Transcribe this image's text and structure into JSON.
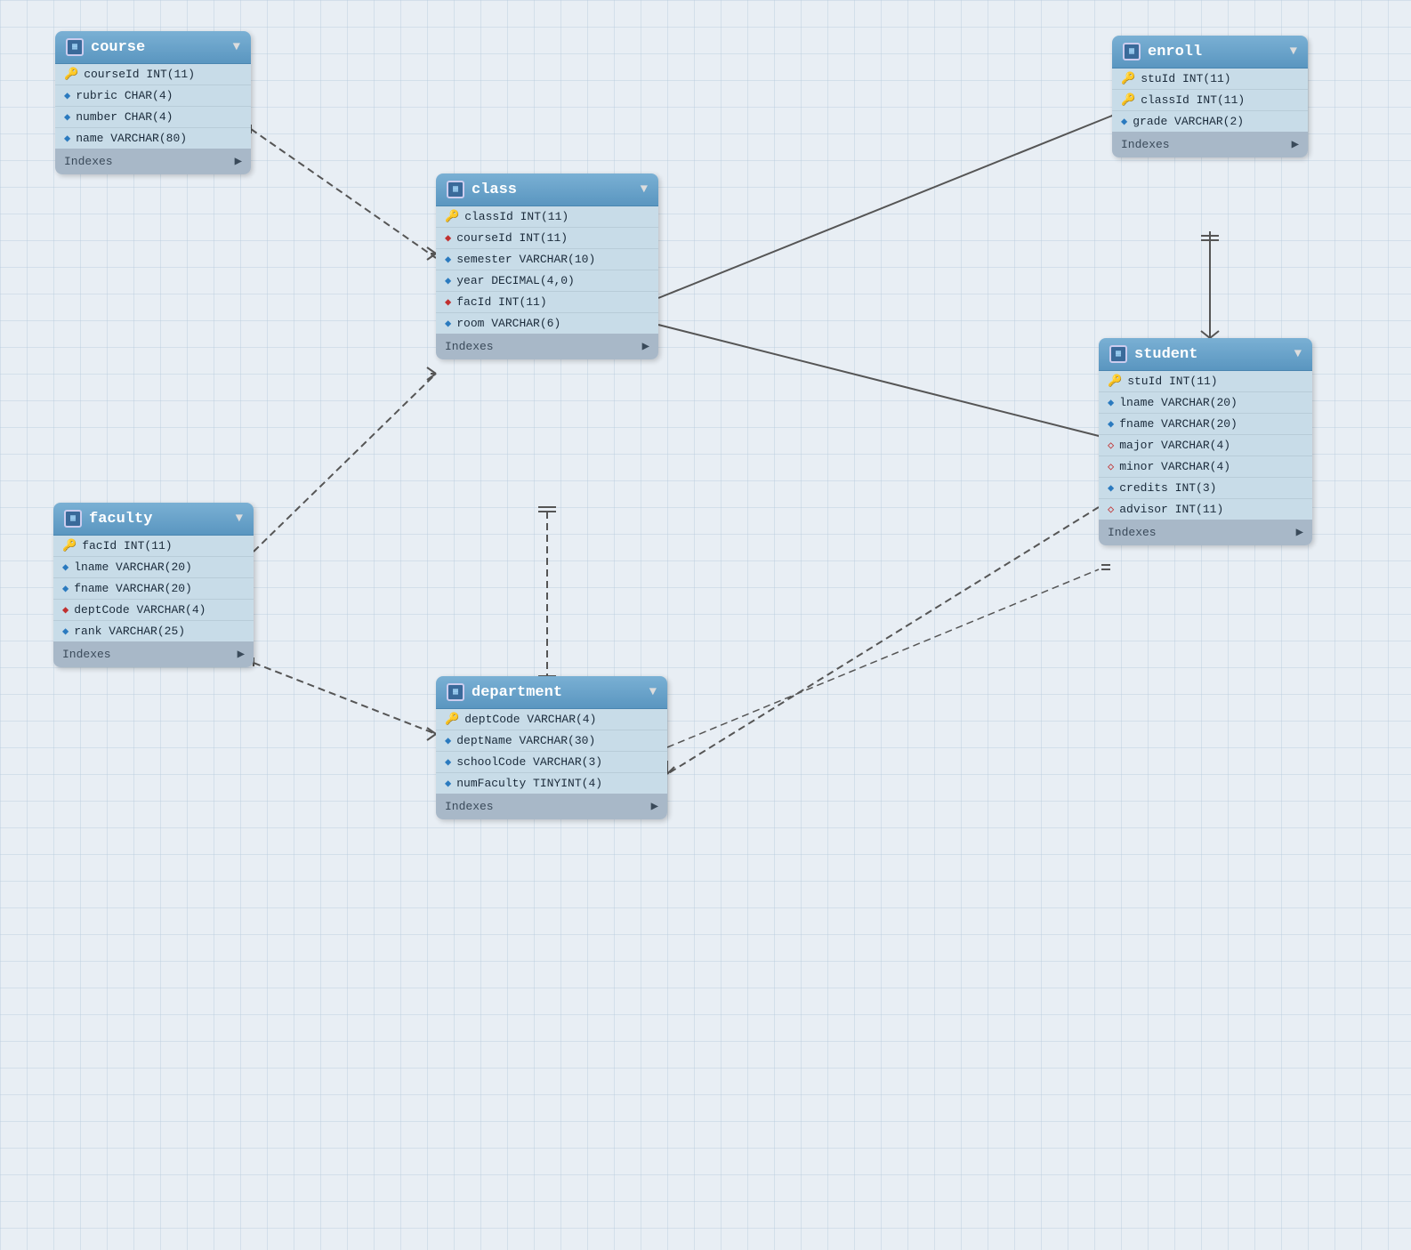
{
  "tables": {
    "course": {
      "title": "course",
      "fields": [
        {
          "icon": "key",
          "text": "courseId INT(11)"
        },
        {
          "icon": "diamond-blue",
          "text": "rubric CHAR(4)"
        },
        {
          "icon": "diamond-blue",
          "text": "number CHAR(4)"
        },
        {
          "icon": "diamond-blue",
          "text": "name VARCHAR(80)"
        }
      ],
      "indexes_label": "Indexes"
    },
    "enroll": {
      "title": "enroll",
      "fields": [
        {
          "icon": "key-red",
          "text": "stuId INT(11)"
        },
        {
          "icon": "key-red",
          "text": "classId INT(11)"
        },
        {
          "icon": "diamond-blue",
          "text": "grade VARCHAR(2)"
        }
      ],
      "indexes_label": "Indexes"
    },
    "class": {
      "title": "class",
      "fields": [
        {
          "icon": "key",
          "text": "classId INT(11)"
        },
        {
          "icon": "diamond-red",
          "text": "courseId INT(11)"
        },
        {
          "icon": "diamond-blue",
          "text": "semester VARCHAR(10)"
        },
        {
          "icon": "diamond-blue",
          "text": "year DECIMAL(4,0)"
        },
        {
          "icon": "diamond-red",
          "text": "facId INT(11)"
        },
        {
          "icon": "diamond-blue",
          "text": "room VARCHAR(6)"
        }
      ],
      "indexes_label": "Indexes"
    },
    "student": {
      "title": "student",
      "fields": [
        {
          "icon": "key",
          "text": "stuId INT(11)"
        },
        {
          "icon": "diamond-blue",
          "text": "lname VARCHAR(20)"
        },
        {
          "icon": "diamond-blue",
          "text": "fname VARCHAR(20)"
        },
        {
          "icon": "diamond-red-open",
          "text": "major VARCHAR(4)"
        },
        {
          "icon": "diamond-red-open",
          "text": "minor VARCHAR(4)"
        },
        {
          "icon": "diamond-blue",
          "text": "credits INT(3)"
        },
        {
          "icon": "diamond-red-open",
          "text": "advisor INT(11)"
        }
      ],
      "indexes_label": "Indexes"
    },
    "faculty": {
      "title": "faculty",
      "fields": [
        {
          "icon": "key",
          "text": "facId INT(11)"
        },
        {
          "icon": "diamond-blue",
          "text": "lname VARCHAR(20)"
        },
        {
          "icon": "diamond-blue",
          "text": "fname VARCHAR(20)"
        },
        {
          "icon": "diamond-red",
          "text": "deptCode VARCHAR(4)"
        },
        {
          "icon": "diamond-blue",
          "text": "rank VARCHAR(25)"
        }
      ],
      "indexes_label": "Indexes"
    },
    "department": {
      "title": "department",
      "fields": [
        {
          "icon": "key",
          "text": "deptCode VARCHAR(4)"
        },
        {
          "icon": "diamond-blue",
          "text": "deptName VARCHAR(30)"
        },
        {
          "icon": "diamond-blue",
          "text": "schoolCode VARCHAR(3)"
        },
        {
          "icon": "diamond-blue",
          "text": "numFaculty TINYINT(4)"
        }
      ],
      "indexes_label": "Indexes"
    }
  },
  "icons": {
    "key": "🔑",
    "key_red": "🔑",
    "diamond_blue": "◆",
    "diamond_red": "◆",
    "table_icon": "▦",
    "dropdown": "▼",
    "arrow_right": "▶"
  }
}
